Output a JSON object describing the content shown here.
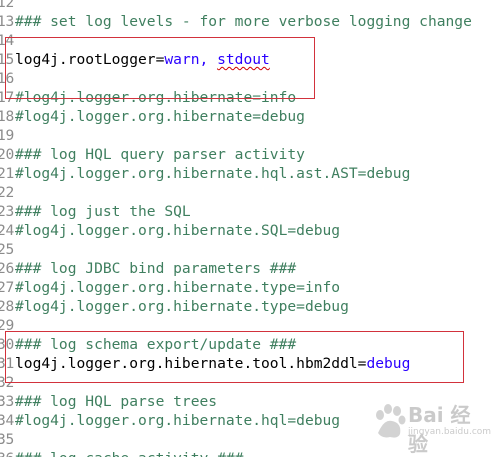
{
  "editor": {
    "lines": [
      {
        "num": "12",
        "text": "",
        "style": "comment"
      },
      {
        "num": "13",
        "text": "### set log levels - for more verbose logging change",
        "style": "comment"
      },
      {
        "num": "14",
        "text": "",
        "style": "comment"
      },
      {
        "num": "15",
        "key": "log4j.rootLogger=",
        "value": "warn, ",
        "extra": "stdout",
        "style": "setting"
      },
      {
        "num": "16",
        "text": "",
        "style": "comment"
      },
      {
        "num": "17",
        "text": "#log4j.logger.org.hibernate=info",
        "style": "comment"
      },
      {
        "num": "18",
        "text": "#log4j.logger.org.hibernate=debug",
        "style": "comment"
      },
      {
        "num": "19",
        "text": "",
        "style": "comment"
      },
      {
        "num": "20",
        "text": "### log HQL query parser activity",
        "style": "comment"
      },
      {
        "num": "21",
        "text": "#log4j.logger.org.hibernate.hql.ast.AST=debug",
        "style": "comment"
      },
      {
        "num": "22",
        "text": "",
        "style": "comment"
      },
      {
        "num": "23",
        "text": "### log just the SQL",
        "style": "comment"
      },
      {
        "num": "24",
        "text": "#log4j.logger.org.hibernate.SQL=debug",
        "style": "comment"
      },
      {
        "num": "25",
        "text": "",
        "style": "comment"
      },
      {
        "num": "26",
        "text": "### log JDBC bind parameters ###",
        "style": "comment"
      },
      {
        "num": "27",
        "text": "#log4j.logger.org.hibernate.type=info",
        "style": "comment"
      },
      {
        "num": "28",
        "text": "#log4j.logger.org.hibernate.type=debug",
        "style": "comment"
      },
      {
        "num": "29",
        "text": "",
        "style": "comment"
      },
      {
        "num": "30",
        "text": "### log schema export/update ###",
        "style": "comment"
      },
      {
        "num": "31",
        "key": "log4j.logger.org.hibernate.tool.hbm2ddl=",
        "value": "debug",
        "extra": "",
        "style": "setting"
      },
      {
        "num": "32",
        "text": "",
        "style": "comment"
      },
      {
        "num": "33",
        "text": "### log HQL parse trees",
        "style": "comment"
      },
      {
        "num": "34",
        "text": "#log4j.logger.org.hibernate.hql=debug",
        "style": "comment"
      },
      {
        "num": "35",
        "text": "",
        "style": "comment"
      },
      {
        "num": "36",
        "text": "### log cache activity ###",
        "style": "comment"
      }
    ]
  },
  "colors": {
    "comment": "#3f7f5f",
    "key": "#000000",
    "value": "#2a00ff",
    "highlight_box": "#d2323c",
    "line_number": "#8c8c8c"
  },
  "watermark": {
    "brand": "Bai 经验",
    "url": "jingyan.baidu.com",
    "icon": "baidu-paw-icon"
  }
}
